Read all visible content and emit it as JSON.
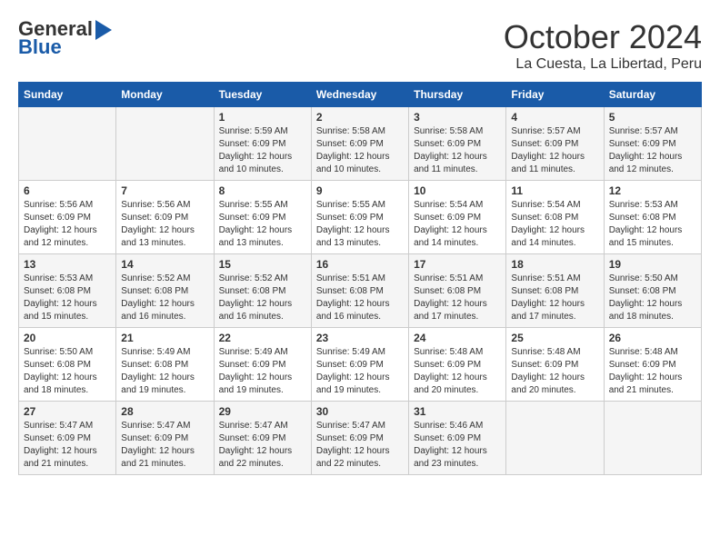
{
  "logo": {
    "line1": "General",
    "line2": "Blue"
  },
  "title": "October 2024",
  "location": "La Cuesta, La Libertad, Peru",
  "days_of_week": [
    "Sunday",
    "Monday",
    "Tuesday",
    "Wednesday",
    "Thursday",
    "Friday",
    "Saturday"
  ],
  "weeks": [
    [
      {
        "day": "",
        "sunrise": "",
        "sunset": "",
        "daylight": ""
      },
      {
        "day": "",
        "sunrise": "",
        "sunset": "",
        "daylight": ""
      },
      {
        "day": "1",
        "sunrise": "Sunrise: 5:59 AM",
        "sunset": "Sunset: 6:09 PM",
        "daylight": "Daylight: 12 hours and 10 minutes."
      },
      {
        "day": "2",
        "sunrise": "Sunrise: 5:58 AM",
        "sunset": "Sunset: 6:09 PM",
        "daylight": "Daylight: 12 hours and 10 minutes."
      },
      {
        "day": "3",
        "sunrise": "Sunrise: 5:58 AM",
        "sunset": "Sunset: 6:09 PM",
        "daylight": "Daylight: 12 hours and 11 minutes."
      },
      {
        "day": "4",
        "sunrise": "Sunrise: 5:57 AM",
        "sunset": "Sunset: 6:09 PM",
        "daylight": "Daylight: 12 hours and 11 minutes."
      },
      {
        "day": "5",
        "sunrise": "Sunrise: 5:57 AM",
        "sunset": "Sunset: 6:09 PM",
        "daylight": "Daylight: 12 hours and 12 minutes."
      }
    ],
    [
      {
        "day": "6",
        "sunrise": "Sunrise: 5:56 AM",
        "sunset": "Sunset: 6:09 PM",
        "daylight": "Daylight: 12 hours and 12 minutes."
      },
      {
        "day": "7",
        "sunrise": "Sunrise: 5:56 AM",
        "sunset": "Sunset: 6:09 PM",
        "daylight": "Daylight: 12 hours and 13 minutes."
      },
      {
        "day": "8",
        "sunrise": "Sunrise: 5:55 AM",
        "sunset": "Sunset: 6:09 PM",
        "daylight": "Daylight: 12 hours and 13 minutes."
      },
      {
        "day": "9",
        "sunrise": "Sunrise: 5:55 AM",
        "sunset": "Sunset: 6:09 PM",
        "daylight": "Daylight: 12 hours and 13 minutes."
      },
      {
        "day": "10",
        "sunrise": "Sunrise: 5:54 AM",
        "sunset": "Sunset: 6:09 PM",
        "daylight": "Daylight: 12 hours and 14 minutes."
      },
      {
        "day": "11",
        "sunrise": "Sunrise: 5:54 AM",
        "sunset": "Sunset: 6:08 PM",
        "daylight": "Daylight: 12 hours and 14 minutes."
      },
      {
        "day": "12",
        "sunrise": "Sunrise: 5:53 AM",
        "sunset": "Sunset: 6:08 PM",
        "daylight": "Daylight: 12 hours and 15 minutes."
      }
    ],
    [
      {
        "day": "13",
        "sunrise": "Sunrise: 5:53 AM",
        "sunset": "Sunset: 6:08 PM",
        "daylight": "Daylight: 12 hours and 15 minutes."
      },
      {
        "day": "14",
        "sunrise": "Sunrise: 5:52 AM",
        "sunset": "Sunset: 6:08 PM",
        "daylight": "Daylight: 12 hours and 16 minutes."
      },
      {
        "day": "15",
        "sunrise": "Sunrise: 5:52 AM",
        "sunset": "Sunset: 6:08 PM",
        "daylight": "Daylight: 12 hours and 16 minutes."
      },
      {
        "day": "16",
        "sunrise": "Sunrise: 5:51 AM",
        "sunset": "Sunset: 6:08 PM",
        "daylight": "Daylight: 12 hours and 16 minutes."
      },
      {
        "day": "17",
        "sunrise": "Sunrise: 5:51 AM",
        "sunset": "Sunset: 6:08 PM",
        "daylight": "Daylight: 12 hours and 17 minutes."
      },
      {
        "day": "18",
        "sunrise": "Sunrise: 5:51 AM",
        "sunset": "Sunset: 6:08 PM",
        "daylight": "Daylight: 12 hours and 17 minutes."
      },
      {
        "day": "19",
        "sunrise": "Sunrise: 5:50 AM",
        "sunset": "Sunset: 6:08 PM",
        "daylight": "Daylight: 12 hours and 18 minutes."
      }
    ],
    [
      {
        "day": "20",
        "sunrise": "Sunrise: 5:50 AM",
        "sunset": "Sunset: 6:08 PM",
        "daylight": "Daylight: 12 hours and 18 minutes."
      },
      {
        "day": "21",
        "sunrise": "Sunrise: 5:49 AM",
        "sunset": "Sunset: 6:08 PM",
        "daylight": "Daylight: 12 hours and 19 minutes."
      },
      {
        "day": "22",
        "sunrise": "Sunrise: 5:49 AM",
        "sunset": "Sunset: 6:09 PM",
        "daylight": "Daylight: 12 hours and 19 minutes."
      },
      {
        "day": "23",
        "sunrise": "Sunrise: 5:49 AM",
        "sunset": "Sunset: 6:09 PM",
        "daylight": "Daylight: 12 hours and 19 minutes."
      },
      {
        "day": "24",
        "sunrise": "Sunrise: 5:48 AM",
        "sunset": "Sunset: 6:09 PM",
        "daylight": "Daylight: 12 hours and 20 minutes."
      },
      {
        "day": "25",
        "sunrise": "Sunrise: 5:48 AM",
        "sunset": "Sunset: 6:09 PM",
        "daylight": "Daylight: 12 hours and 20 minutes."
      },
      {
        "day": "26",
        "sunrise": "Sunrise: 5:48 AM",
        "sunset": "Sunset: 6:09 PM",
        "daylight": "Daylight: 12 hours and 21 minutes."
      }
    ],
    [
      {
        "day": "27",
        "sunrise": "Sunrise: 5:47 AM",
        "sunset": "Sunset: 6:09 PM",
        "daylight": "Daylight: 12 hours and 21 minutes."
      },
      {
        "day": "28",
        "sunrise": "Sunrise: 5:47 AM",
        "sunset": "Sunset: 6:09 PM",
        "daylight": "Daylight: 12 hours and 21 minutes."
      },
      {
        "day": "29",
        "sunrise": "Sunrise: 5:47 AM",
        "sunset": "Sunset: 6:09 PM",
        "daylight": "Daylight: 12 hours and 22 minutes."
      },
      {
        "day": "30",
        "sunrise": "Sunrise: 5:47 AM",
        "sunset": "Sunset: 6:09 PM",
        "daylight": "Daylight: 12 hours and 22 minutes."
      },
      {
        "day": "31",
        "sunrise": "Sunrise: 5:46 AM",
        "sunset": "Sunset: 6:09 PM",
        "daylight": "Daylight: 12 hours and 23 minutes."
      },
      {
        "day": "",
        "sunrise": "",
        "sunset": "",
        "daylight": ""
      },
      {
        "day": "",
        "sunrise": "",
        "sunset": "",
        "daylight": ""
      }
    ]
  ]
}
